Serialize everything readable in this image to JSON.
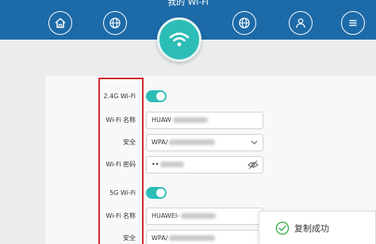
{
  "header": {
    "title": "我的 Wi-Fi",
    "nav_icons": [
      "home-icon",
      "globe-icon",
      "wifi-icon",
      "network-icon",
      "user-icon",
      "menu-icon"
    ]
  },
  "wifi_24g": {
    "section_label": "2.4G Wi-Fi",
    "enabled": true,
    "name_label": "Wi-Fi 名称",
    "name_value": "HUAW",
    "security_label": "安全",
    "security_value": "WPA/",
    "password_label": "Wi-Fi 密码",
    "password_value": "••"
  },
  "wifi_5g": {
    "section_label": "5G Wi-Fi",
    "enabled": true,
    "name_label": "Wi-Fi 名称",
    "name_value": "HUAWEI-",
    "security_label": "安全",
    "security_value": "WPA/"
  },
  "toast": {
    "message": "复制成功",
    "icon": "check-circle-icon"
  },
  "colors": {
    "header_bg": "#1d6aa8",
    "accent": "#2dbdb7",
    "highlight_border": "#d0262e",
    "success": "#3fae49"
  }
}
